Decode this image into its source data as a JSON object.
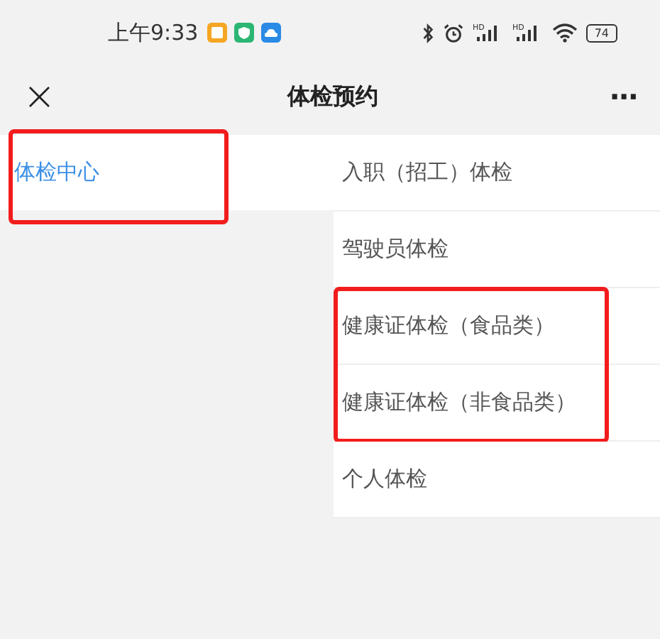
{
  "status_bar": {
    "time": "上午9:33",
    "signals": [
      {
        "label": "HD"
      },
      {
        "label": "HD"
      }
    ],
    "battery": "74"
  },
  "nav": {
    "title": "体检预约",
    "close": "×",
    "more": "···"
  },
  "sidebar": {
    "items": [
      {
        "label": "体检中心",
        "selected": true,
        "highlighted": true
      }
    ]
  },
  "list": {
    "groups": [
      {
        "highlighted": false,
        "items": [
          "入职（招工）体检",
          "驾驶员体检"
        ]
      },
      {
        "highlighted": true,
        "items": [
          "健康证体检（食品类）",
          "健康证体检（非食品类）"
        ]
      },
      {
        "highlighted": false,
        "items": [
          "个人体检"
        ]
      }
    ]
  }
}
